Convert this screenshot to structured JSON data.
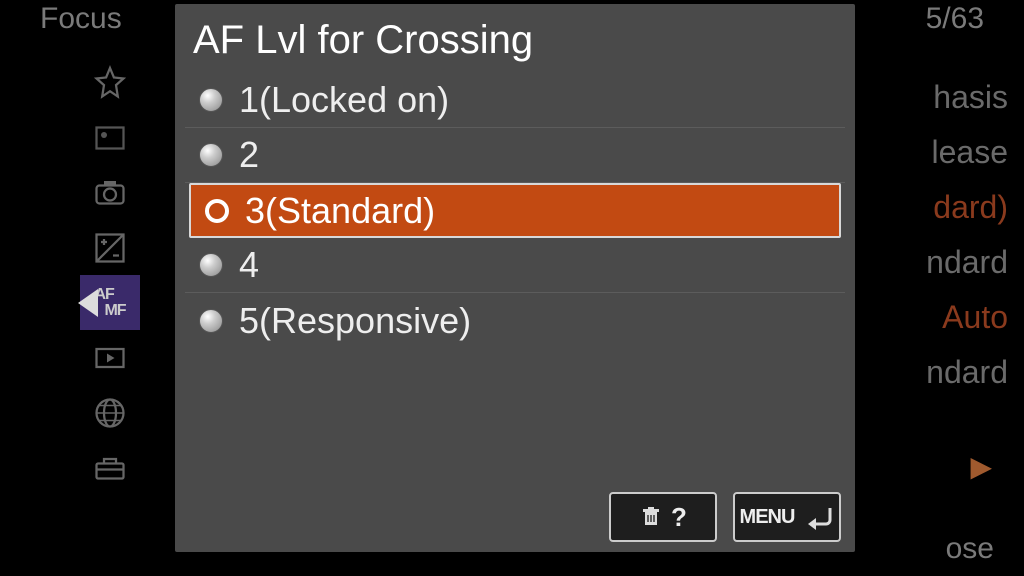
{
  "background": {
    "header_left": "Focus",
    "header_right": "5/63",
    "right_values": [
      "hasis",
      "lease",
      "dard)",
      "ndard",
      "Auto",
      "ndard"
    ],
    "close": "ose"
  },
  "sidebar": {
    "items": [
      {
        "name": "star"
      },
      {
        "name": "exposure"
      },
      {
        "name": "camera"
      },
      {
        "name": "exposure-comp"
      },
      {
        "name": "afmf",
        "label_top": "AF",
        "label_bottom": "MF"
      },
      {
        "name": "playback"
      },
      {
        "name": "globe"
      },
      {
        "name": "toolbox"
      }
    ],
    "active_index": 4
  },
  "dialog": {
    "title": "AF Lvl for Crossing",
    "options": [
      {
        "label": "1(Locked on)"
      },
      {
        "label": "2"
      },
      {
        "label": "3(Standard)"
      },
      {
        "label": "4"
      },
      {
        "label": "5(Responsive)"
      }
    ],
    "selected_index": 2,
    "footer": {
      "help_label": "?",
      "menu_label": "MENU"
    }
  }
}
